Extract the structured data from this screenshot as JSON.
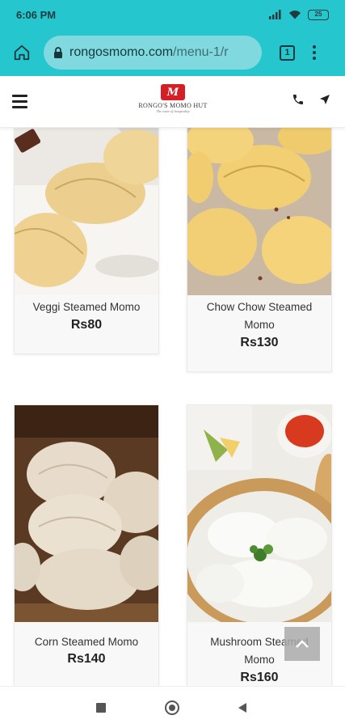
{
  "status_bar": {
    "time": "6:06 PM",
    "battery": "25"
  },
  "browser": {
    "url_domain": "rongosmomo.com",
    "url_path": "/menu-1/r",
    "tab_count": "1"
  },
  "site": {
    "logo_mark": "M",
    "logo_name": "RONGO'S MOMO HUT",
    "logo_tagline": "The taste of hospitality"
  },
  "menu_items": [
    {
      "name": "Veggi Steamed Momo",
      "price": "Rs80"
    },
    {
      "name": "Chow Chow Steamed Momo",
      "price": "Rs130"
    },
    {
      "name": "Corn Steamed Momo",
      "price": "Rs140"
    },
    {
      "name": "Mushroom Steamed Momo",
      "price": "Rs160"
    }
  ],
  "colors": {
    "browser_bar": "#26c6cf",
    "logo_red": "#d41f26"
  },
  "icons": {
    "home": "home-icon",
    "lock": "lock-icon",
    "menu": "hamburger-icon",
    "phone": "phone-icon",
    "navigate": "navigation-arrow-icon",
    "scroll_top": "chevron-up-icon"
  }
}
